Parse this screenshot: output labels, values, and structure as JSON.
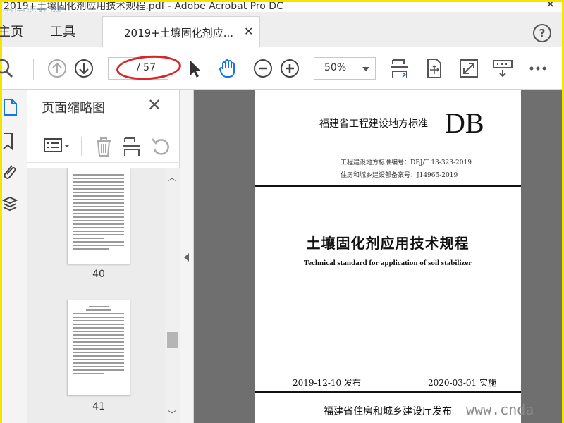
{
  "window": {
    "title": "2019+土壤固化剂应用技术规程.pdf - Adobe Acrobat Pro DC",
    "watermark_top": "中国道桥网",
    "watermark_bottom": "www.cnda"
  },
  "tabs": {
    "home": "主页",
    "tools": "工具",
    "document": "2019+土壤固化剂应...",
    "help": "?"
  },
  "toolbar": {
    "current_page": "",
    "page_total": "/ 57",
    "zoom": "50%"
  },
  "thumbnails": {
    "title": "页面缩略图",
    "pages": [
      {
        "number": "40"
      },
      {
        "number": "41"
      }
    ]
  },
  "document": {
    "org_label": "福建省工程建设地方标准",
    "db_mark": "DB",
    "standard_code": "工程建设地方标准编号：DBJ/T 13-323-2019",
    "record_number": "住房和城乡建设部备案号：J14965-2019",
    "title_cn": "土壤固化剂应用技术规程",
    "title_en": "Technical standard for application of soil stabilizer",
    "issue_date": "2019-12-10 发布",
    "implement_date": "2020-03-01 实施",
    "publisher": "福建省住房和城乡建设厅发布"
  },
  "colors": {
    "accent_blue": "#1473e6",
    "annotation_red": "#d9262d",
    "frame_yellow": "#f4e400"
  }
}
